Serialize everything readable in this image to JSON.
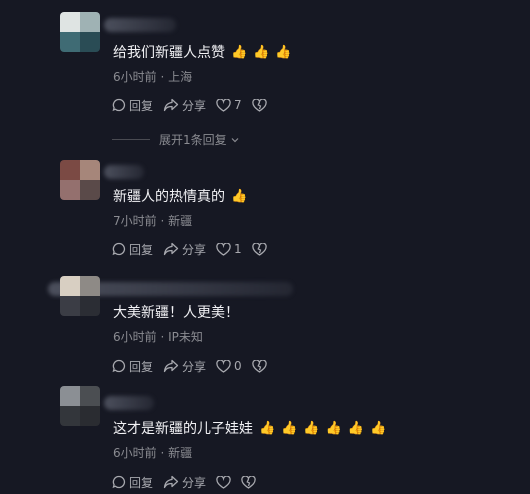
{
  "comments": [
    {
      "text": "给我们新疆人点赞",
      "emojis": [
        "👍",
        "👍",
        "👍"
      ],
      "time": "6小时前",
      "location": "上海",
      "reply_label": "回复",
      "share_label": "分享",
      "like_count": "7",
      "avatar_colors": [
        "#dfe4e3",
        "#9fb2b4",
        "#3f6b74",
        "#2a4c55"
      ]
    },
    {
      "text": "新疆人的热情真的",
      "emojis": [
        "👍"
      ],
      "time": "7小时前",
      "location": "新疆",
      "reply_label": "回复",
      "share_label": "分享",
      "like_count": "1",
      "avatar_colors": [
        "#7b4a44",
        "#a6867a",
        "#94706e",
        "#5a4a49"
      ]
    },
    {
      "text": "大美新疆！人更美！",
      "emojis": [],
      "time": "6小时前",
      "location": "IP未知",
      "reply_label": "回复",
      "share_label": "分享",
      "like_count": "0",
      "avatar_colors": [
        "#d8cfc2",
        "#8e8a86",
        "#3b3d45",
        "#2b2d34"
      ]
    },
    {
      "text": "这才是新疆的儿子娃娃",
      "emojis": [
        "👍",
        "👍",
        "👍",
        "👍",
        "👍",
        "👍"
      ],
      "time": "6小时前",
      "location": "新疆",
      "reply_label": "回复",
      "share_label": "分享",
      "like_count": "",
      "avatar_colors": [
        "#8b8f94",
        "#4b4e52",
        "#33363b",
        "#2a2c31"
      ]
    }
  ],
  "expand_replies": "展开1条回复",
  "meta_separator": "·"
}
